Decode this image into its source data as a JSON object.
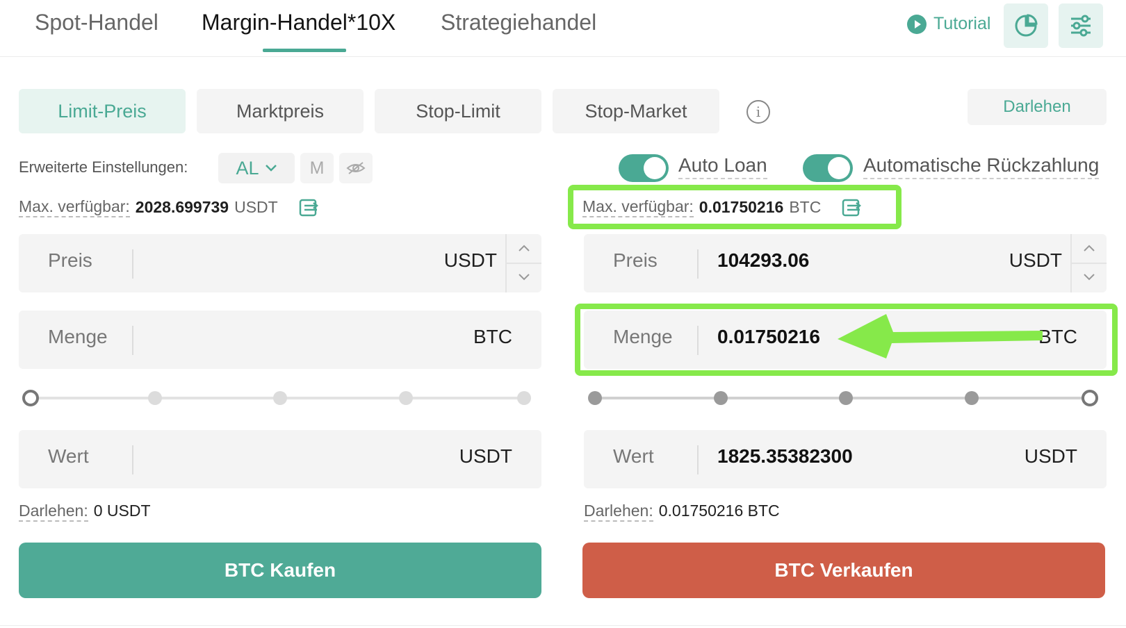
{
  "tabs": [
    {
      "label": "Spot-Handel",
      "active": false
    },
    {
      "label": "Margin-Handel*10X",
      "active": true
    },
    {
      "label": "Strategiehandel",
      "active": false
    }
  ],
  "header": {
    "tutorial_label": "Tutorial"
  },
  "order_types": [
    "Limit-Preis",
    "Marktpreis",
    "Stop-Limit",
    "Stop-Market"
  ],
  "loan_button": "Darlehen",
  "advanced": {
    "label": "Erweiterte Einstellungen:",
    "mode": "AL",
    "m_label": "M"
  },
  "toggles": {
    "auto_loan": "Auto Loan",
    "auto_repay": "Automatische Rückzahlung"
  },
  "buy": {
    "max_label": "Max. verfügbar:",
    "max_value": "2028.699739",
    "max_unit": "USDT",
    "price": {
      "label": "Preis",
      "value": "",
      "unit": "USDT"
    },
    "amount": {
      "label": "Menge",
      "value": "",
      "unit": "BTC"
    },
    "slider_level": 0,
    "total": {
      "label": "Wert",
      "value": "",
      "unit": "USDT"
    },
    "loan_label": "Darlehen:",
    "loan_value": "0 USDT",
    "action": "BTC Kaufen"
  },
  "sell": {
    "max_label": "Max. verfügbar:",
    "max_value": "0.01750216",
    "max_unit": "BTC",
    "price": {
      "label": "Preis",
      "value": "104293.06",
      "unit": "USDT"
    },
    "amount": {
      "label": "Menge",
      "value": "0.01750216",
      "unit": "BTC"
    },
    "slider_level": 1,
    "total": {
      "label": "Wert",
      "value": "1825.35382300",
      "unit": "USDT"
    },
    "loan_label": "Darlehen:",
    "loan_value": "0.01750216 BTC",
    "action": "BTC Verkaufen"
  },
  "colors": {
    "accent": "#4aa994",
    "sell": "#cf5e48",
    "highlight": "#86e94a"
  }
}
